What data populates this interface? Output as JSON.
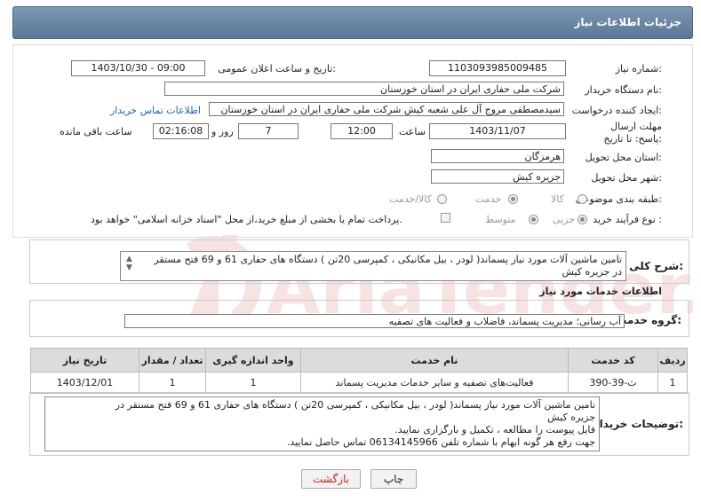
{
  "header": {
    "title": "جزئیات اطلاعات نیاز"
  },
  "watermark": {
    "text": "AriaTender.neT"
  },
  "form": {
    "need_number": {
      "label": "شماره نیاز:",
      "value": "1103093985009485"
    },
    "announce_datetime": {
      "label": "تاریخ و ساعت اعلان عمومی:",
      "value": "1403/10/30 - 09:00"
    },
    "buyer_org": {
      "label": "نام دستگاه خریدار:",
      "value": "شرکت ملی حفاری ایران در استان خوزستان"
    },
    "requester": {
      "label": "ایجاد کننده درخواست:",
      "value": "سیدمصطفی مروج آل علی شعبه کیش شرکت ملی حفاری ایران در استان خوزستان",
      "contact_link": "اطلاعات تماس خریدار"
    },
    "deadline": {
      "label": "مهلت ارسال پاسخ: تا تاریخ:",
      "date": "1403/11/07",
      "time_label": "ساعت",
      "time": "12:00",
      "days": "7",
      "days_label": "روز و",
      "remaining": "02:16:08",
      "remaining_label": "ساعت باقی مانده"
    },
    "delivery_province": {
      "label": "استان محل تحویل:",
      "value": "هرمزگان"
    },
    "delivery_city": {
      "label": "شهر محل تحویل:",
      "value": "جزیره کیش"
    },
    "category": {
      "label": "طبقه بندی موضوعی:",
      "options": [
        "کالا",
        "خدمت",
        "کالا/خدمت"
      ],
      "selected": "خدمت"
    },
    "purchase_type": {
      "label": "نوع فرآیند خرید :",
      "options": [
        "جزیی",
        "متوسط"
      ],
      "selected": "جزیی",
      "treasury_note": "پرداخت تمام یا بخشی از مبلغ خرید،از محل \"اسناد خزانه اسلامی\" خواهد بود."
    }
  },
  "summary": {
    "label": "شرح کلی نیاز:",
    "text": "تامین ماشین آلات مورد نیاز پسماند( لودر ، بیل مکانیکی ، کمپرسی 20تن ) دستگاه های حفاری 61 و 69 فتح مستقر در جزیره کیش"
  },
  "services": {
    "title": "اطلاعات خدمات مورد نیاز",
    "group_label": "گروه خدمت:",
    "group_value": "آب رسانی؛ مدیریت پسماند، فاضلاب و فعالیت های تصفیه",
    "columns": [
      "ردیف",
      "کد خدمت",
      "نام خدمت",
      "واحد اندازه گیری",
      "تعداد / مقدار",
      "تاریخ نیاز"
    ],
    "rows": [
      {
        "row": "1",
        "code": "ث-39-390",
        "name": "فعالیت‌های تصفیه و سایر خدمات مدیریت پسماند",
        "unit": "1",
        "qty": "1",
        "date": "1403/12/01"
      }
    ]
  },
  "buyer_notes": {
    "label": "توضیحات خریدار:",
    "lines": [
      "تامین ماشین آلات مورد نیاز پسماند( لودر ، بیل مکانیکی ، کمپرسی 20تن ) دستگاه های حفاری 61 و 69 فتح مستقر در",
      "جزیره کیش",
      "فایل پیوست را مطالعه  ، تکمیل و بارگزاری نمایید.",
      "جهت رفع هر گونه ابهام با شماره تلفن 06134145966 تماس حاصل نمایید."
    ]
  },
  "buttons": {
    "print": "چاپ",
    "back": "بازگشت"
  },
  "colors": {
    "header": "#6a86a3",
    "watermark": "#cc3333",
    "back_button_text": "#cc2222"
  }
}
